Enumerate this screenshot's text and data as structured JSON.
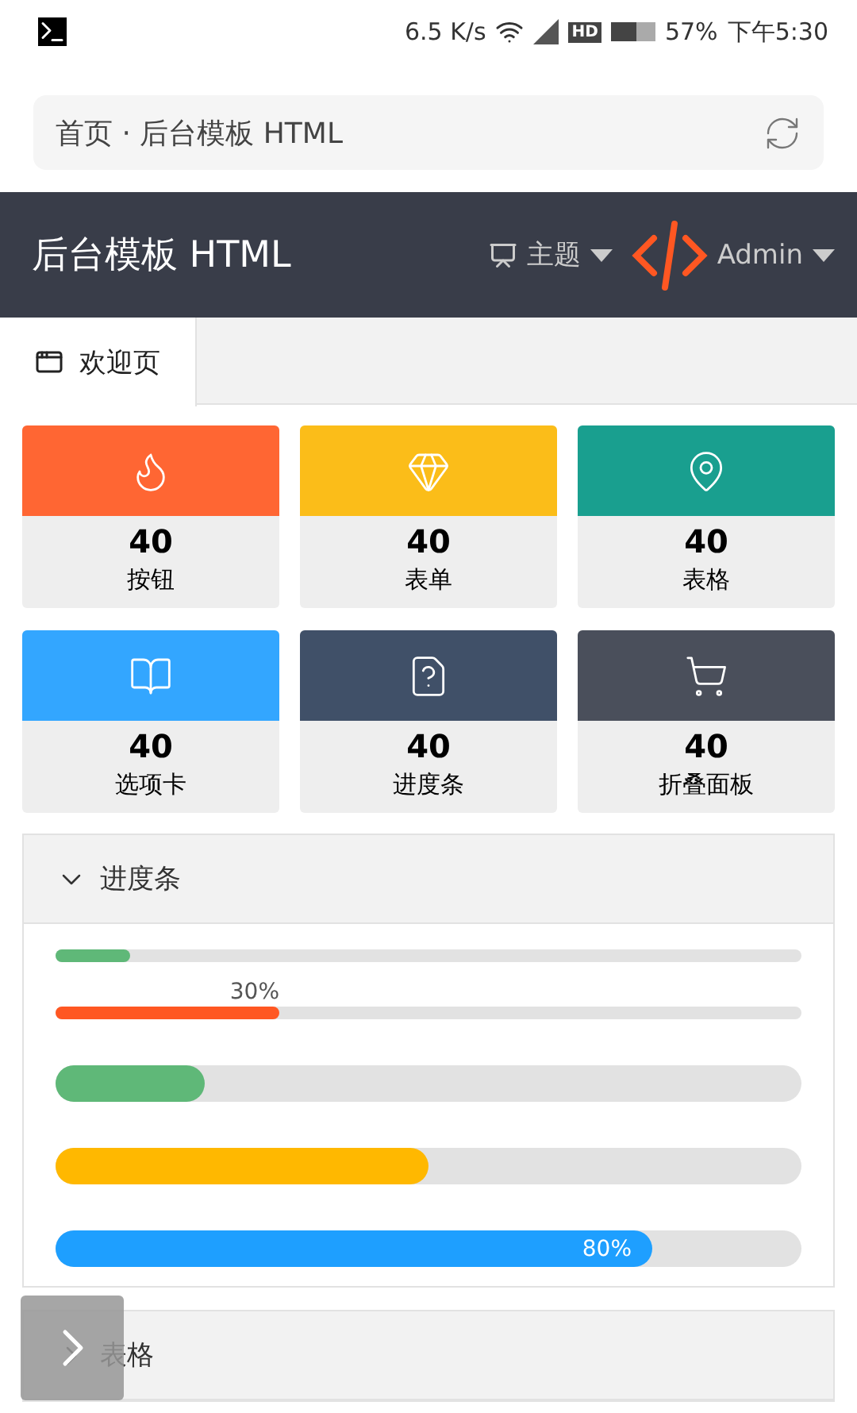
{
  "status_bar": {
    "speed": "6.5 K/s",
    "hd_badge": "HD",
    "battery": "57%",
    "time": "下午5:30"
  },
  "address_bar": {
    "text": "首页 · 后台模板 HTML"
  },
  "header": {
    "title": "后台模板 HTML",
    "theme_menu": "主题",
    "user_menu": "Admin"
  },
  "tabs": [
    {
      "label": "欢迎页",
      "selected": true
    }
  ],
  "tiles": [
    {
      "kind": "flame",
      "color": "#ff6633",
      "count": "40",
      "label": "按钮"
    },
    {
      "kind": "gem",
      "color": "#fbbd19",
      "count": "40",
      "label": "表单"
    },
    {
      "kind": "pin",
      "color": "#199f8f",
      "count": "40",
      "label": "表格"
    },
    {
      "kind": "book",
      "color": "#33a6ff",
      "count": "40",
      "label": "选项卡"
    },
    {
      "kind": "note",
      "color": "#405068",
      "count": "40",
      "label": "进度条"
    },
    {
      "kind": "cart",
      "color": "#4a4f5b",
      "count": "40",
      "label": "折叠面板"
    }
  ],
  "panels": [
    {
      "title": "进度条",
      "expanded": true,
      "bars": [
        {
          "kind": "thin",
          "color": "#5fb878",
          "level": 0.1
        },
        {
          "kind": "thin",
          "color": "#ff5722",
          "level": 0.3,
          "label": "30%"
        },
        {
          "kind": "thick",
          "color": "#5fb878",
          "level": 0.2
        },
        {
          "kind": "thick",
          "color": "#ffb800",
          "level": 0.5
        },
        {
          "kind": "thick",
          "color": "#1e9fff",
          "level": 0.8,
          "label": "80%"
        }
      ]
    },
    {
      "title": "表格",
      "expanded": false
    }
  ]
}
